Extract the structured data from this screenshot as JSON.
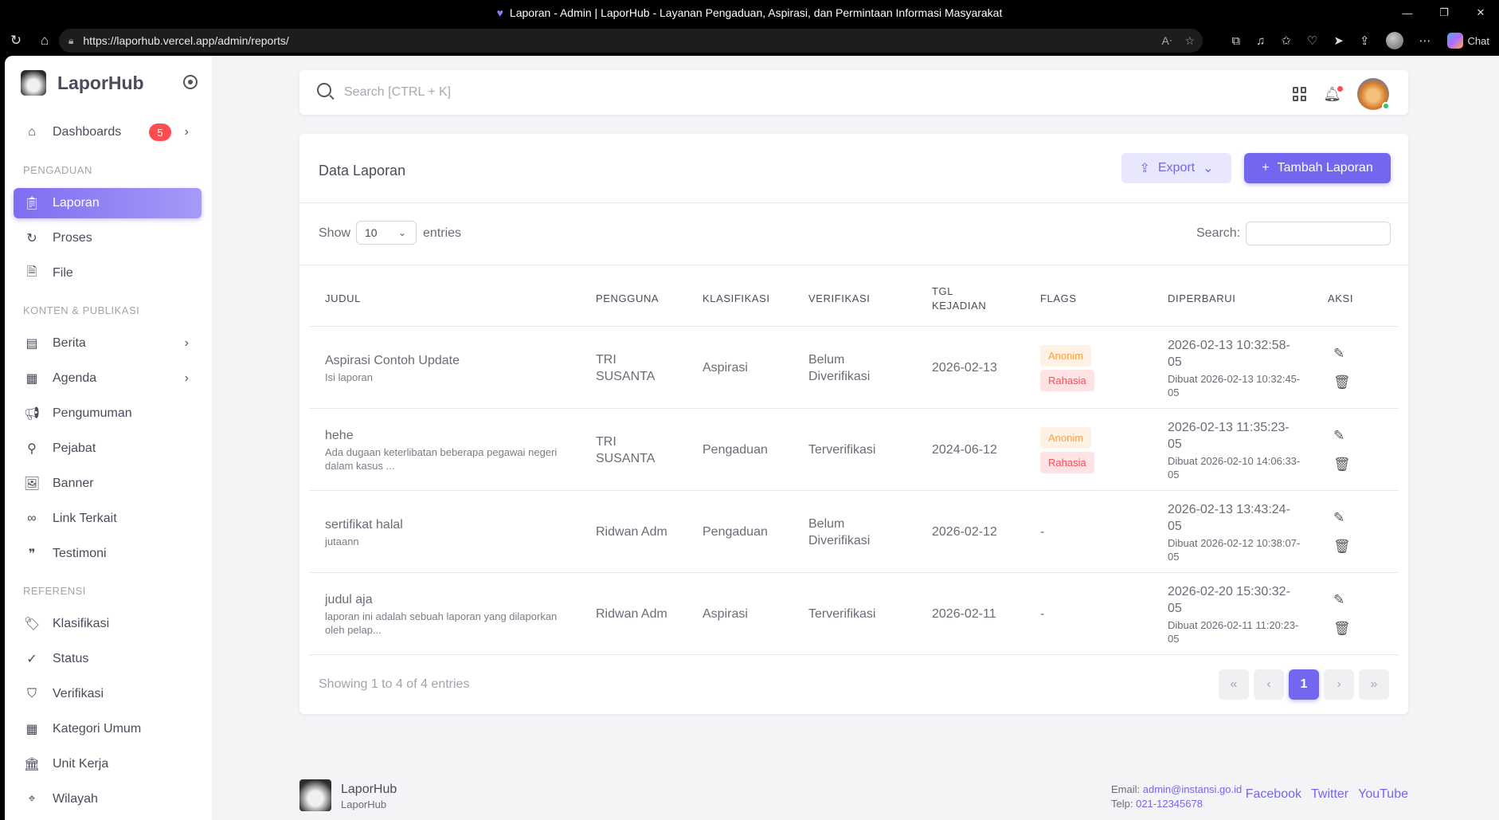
{
  "browser": {
    "title": "Laporan - Admin | LaporHub - Layanan Pengaduan, Aspirasi, dan Permintaan Informasi Masyarakat",
    "url": "https://laporhub.vercel.app/admin/reports/",
    "chat_label": "Chat"
  },
  "sidebar": {
    "brand": "LaporHub",
    "dashboards": {
      "label": "Dashboards",
      "badge": "5"
    },
    "sections": {
      "pengaduan": "PENGADUAN",
      "konten": "KONTEN & PUBLIKASI",
      "referensi": "REFERENSI"
    },
    "items": {
      "laporan": "Laporan",
      "proses": "Proses",
      "file": "File",
      "berita": "Berita",
      "agenda": "Agenda",
      "pengumuman": "Pengumuman",
      "pejabat": "Pejabat",
      "banner": "Banner",
      "link_terkait": "Link Terkait",
      "testimoni": "Testimoni",
      "klasifikasi": "Klasifikasi",
      "status": "Status",
      "verifikasi": "Verifikasi",
      "kategori_umum": "Kategori Umum",
      "unit_kerja": "Unit Kerja",
      "wilayah": "Wilayah"
    }
  },
  "navbar": {
    "search_placeholder": "Search [CTRL + K]"
  },
  "card": {
    "title": "Data Laporan",
    "export_label": "Export",
    "add_label": "Tambah Laporan",
    "show_label": "Show",
    "page_size": "10",
    "entries_label": "entries",
    "search_label": "Search:",
    "columns": {
      "judul": "JUDUL",
      "pengguna": "PENGGUNA",
      "klasifikasi": "KLASIFIKASI",
      "verifikasi": "VERIFIKASI",
      "tgl_1": "TGL",
      "tgl_2": "KEJADIAN",
      "flags": "FLAGS",
      "diperbarui": "DIPERBARUI",
      "aksi": "AKSI"
    },
    "rows": [
      {
        "judul": "Aspirasi Contoh Update",
        "desc": "Isi laporan",
        "pengguna": "TRI SUSANTA",
        "klasifikasi": "Aspirasi",
        "verifikasi": "Belum Diverifikasi",
        "tgl": "2026-02-13",
        "flag_anon": "Anonim",
        "flag_secret": "Rahasia",
        "flag_none": "",
        "updated": "2026-02-13 10:32:58-05",
        "created": "Dibuat 2026-02-13 10:32:45-05"
      },
      {
        "judul": "hehe",
        "desc": "Ada dugaan keterlibatan beberapa pegawai negeri dalam kasus ...",
        "pengguna": "TRI SUSANTA",
        "klasifikasi": "Pengaduan",
        "verifikasi": "Terverifikasi",
        "tgl": "2024-06-12",
        "flag_anon": "Anonim",
        "flag_secret": "Rahasia",
        "flag_none": "",
        "updated": "2026-02-13 11:35:23-05",
        "created": "Dibuat 2026-02-10 14:06:33-05"
      },
      {
        "judul": "sertifikat halal",
        "desc": "jutaann",
        "pengguna": "Ridwan Adm",
        "klasifikasi": "Pengaduan",
        "verifikasi": "Belum Diverifikasi",
        "tgl": "2026-02-12",
        "flag_anon": "",
        "flag_secret": "",
        "flag_none": "-",
        "updated": "2026-02-13 13:43:24-05",
        "created": "Dibuat 2026-02-12 10:38:07-05"
      },
      {
        "judul": "judul aja",
        "desc": "laporan ini adalah sebuah laporan yang dilaporkan oleh pelap...",
        "pengguna": "Ridwan Adm",
        "klasifikasi": "Aspirasi",
        "verifikasi": "Terverifikasi",
        "tgl": "2026-02-11",
        "flag_anon": "",
        "flag_secret": "",
        "flag_none": "-",
        "updated": "2026-02-20 15:30:32-05",
        "created": "Dibuat 2026-02-11 11:20:23-05"
      }
    ],
    "showing": "Showing 1 to 4 of 4 entries",
    "pager": {
      "first": "«",
      "prev": "‹",
      "current": "1",
      "next": "›",
      "last": "»"
    }
  },
  "footer": {
    "name": "LaporHub",
    "sub": "LaporHub",
    "email_label": "Email:",
    "email": "admin@instansi.go.id",
    "phone_label": "Telp:",
    "phone": "021-12345678",
    "links": {
      "facebook": "Facebook",
      "twitter": "Twitter",
      "youtube": "YouTube"
    }
  }
}
